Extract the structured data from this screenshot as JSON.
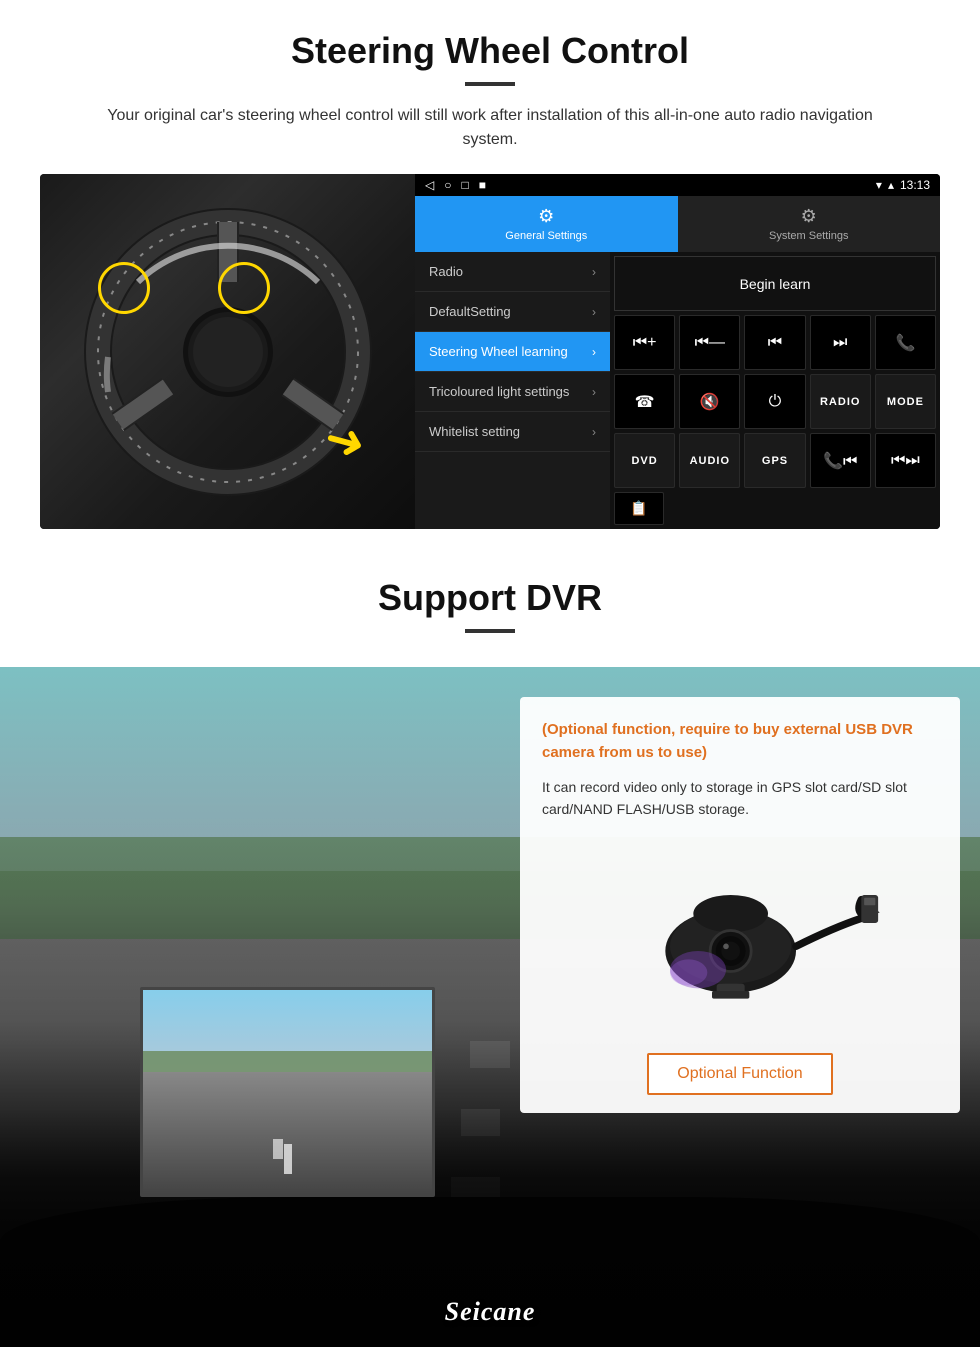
{
  "page": {
    "section1": {
      "title": "Steering Wheel Control",
      "subtitle": "Your original car's steering wheel control will still work after installation of this all-in-one auto radio navigation system.",
      "statusbar": {
        "time": "13:13",
        "nav_icons": [
          "◁",
          "○",
          "□",
          "■"
        ]
      },
      "tabs": [
        {
          "label": "General Settings",
          "icon": "⚙",
          "active": true
        },
        {
          "label": "System Settings",
          "icon": "🔧",
          "active": false
        }
      ],
      "menu_items": [
        {
          "label": "Radio",
          "active": false
        },
        {
          "label": "DefaultSetting",
          "active": false
        },
        {
          "label": "Steering Wheel learning",
          "active": true
        },
        {
          "label": "Tricoloured light settings",
          "active": false
        },
        {
          "label": "Whitelist setting",
          "active": false
        }
      ],
      "begin_learn_label": "Begin learn",
      "control_buttons": [
        [
          "⏮+",
          "⏮—",
          "⏮⏮",
          "⏭⏭",
          "📞"
        ],
        [
          "☎",
          "🔇",
          "⏻",
          "RADIO",
          "MODE"
        ],
        [
          "DVD",
          "AUDIO",
          "GPS",
          "📞⏮",
          "⏮⏭"
        ]
      ]
    },
    "section2": {
      "title": "Support DVR",
      "optional_heading": "(Optional function, require to buy external USB DVR camera from us to use)",
      "description": "It can record video only to storage in GPS slot card/SD slot card/NAND FLASH/USB storage.",
      "optional_fn_label": "Optional Function",
      "seicane_logo": "Seicane"
    }
  }
}
